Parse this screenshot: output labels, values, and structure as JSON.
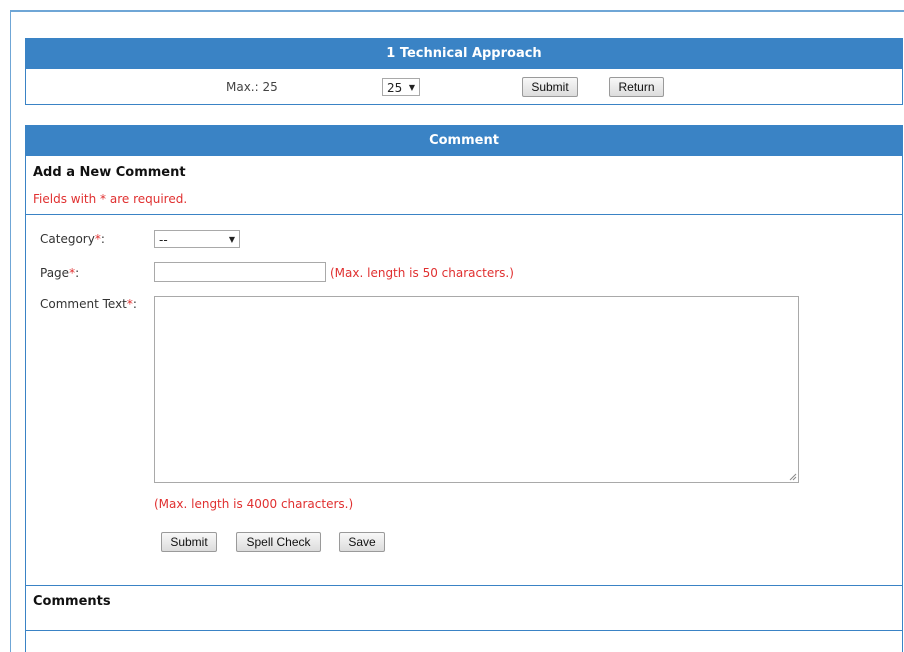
{
  "score_panel": {
    "title": "1 Technical Approach",
    "max_label": "Max.: 25",
    "score_value": "25",
    "submit_label": "Submit",
    "return_label": "Return"
  },
  "comment_panel": {
    "title": "Comment",
    "add_title": "Add a New Comment",
    "required_note": "Fields with * are required.",
    "category_label": "Category",
    "category_value": "--",
    "page_label": "Page",
    "page_value": "",
    "page_hint": "(Max. length is 50 characters.)",
    "comment_text_label": "Comment Text",
    "comment_text_value": "",
    "comment_hint": "(Max. length is 4000 characters.)",
    "submit_label": "Submit",
    "spell_check_label": "Spell Check",
    "save_label": "Save",
    "comments_title": "Comments"
  },
  "colors": {
    "header_blue": "#3a83c5",
    "required_red": "#e03030"
  }
}
